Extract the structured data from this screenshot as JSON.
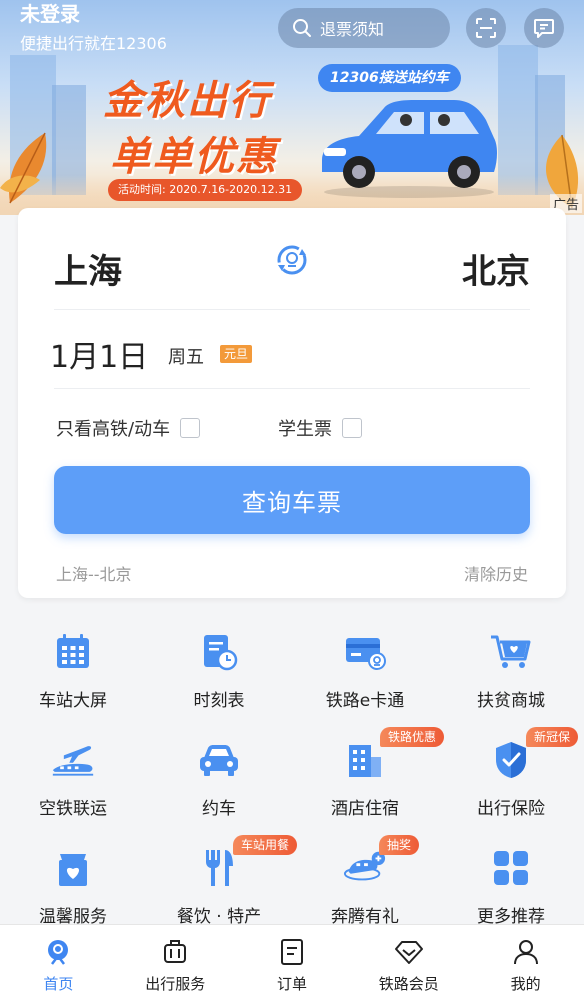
{
  "header": {
    "login_title": "未登录",
    "login_subtitle": "便捷出行就在12306",
    "search_label": "退票须知"
  },
  "banner": {
    "headline_line1": "金秋出行",
    "headline_line2": "单单优惠",
    "campaign_period": "活动时间: 2020.7.16-2020.12.31",
    "tag": "12306接送站约车",
    "ad_label": "广告"
  },
  "ticket": {
    "from_city": "上海",
    "to_city": "北京",
    "date": "1月1日",
    "weekday": "周五",
    "holiday_tag": "元旦",
    "option_high_speed": "只看高铁/动车",
    "option_student": "学生票",
    "query_button": "查询车票",
    "history_route": "上海--北京",
    "clear_history": "清除历史"
  },
  "services": [
    {
      "label": "车站大屏",
      "icon": "station-screen-icon"
    },
    {
      "label": "时刻表",
      "icon": "timetable-icon"
    },
    {
      "label": "铁路e卡通",
      "icon": "ecard-icon"
    },
    {
      "label": "扶贫商城",
      "icon": "shopping-cart-icon"
    },
    {
      "label": "空铁联运",
      "icon": "air-rail-icon"
    },
    {
      "label": "约车",
      "icon": "car-icon"
    },
    {
      "label": "酒店住宿",
      "icon": "hotel-icon",
      "badge": "铁路优惠"
    },
    {
      "label": "出行保险",
      "icon": "insurance-shield-icon",
      "badge": "新冠保"
    },
    {
      "label": "温馨服务",
      "icon": "heart-service-icon"
    },
    {
      "label": "餐饮 · 特产",
      "icon": "dining-icon",
      "badge": "车站用餐"
    },
    {
      "label": "奔腾有礼",
      "icon": "gift-train-icon",
      "badge": "抽奖"
    },
    {
      "label": "更多推荐",
      "icon": "more-grid-icon"
    }
  ],
  "tabs": [
    {
      "label": "首页",
      "icon": "home-train-icon",
      "active": true
    },
    {
      "label": "出行服务",
      "icon": "luggage-icon"
    },
    {
      "label": "订单",
      "icon": "order-icon"
    },
    {
      "label": "铁路会员",
      "icon": "diamond-icon"
    },
    {
      "label": "我的",
      "icon": "profile-icon"
    }
  ],
  "colors": {
    "accent": "#3f86f1",
    "button": "#5d9ef8",
    "badge": "#ee5b36",
    "promo": "#ef5a1e"
  }
}
